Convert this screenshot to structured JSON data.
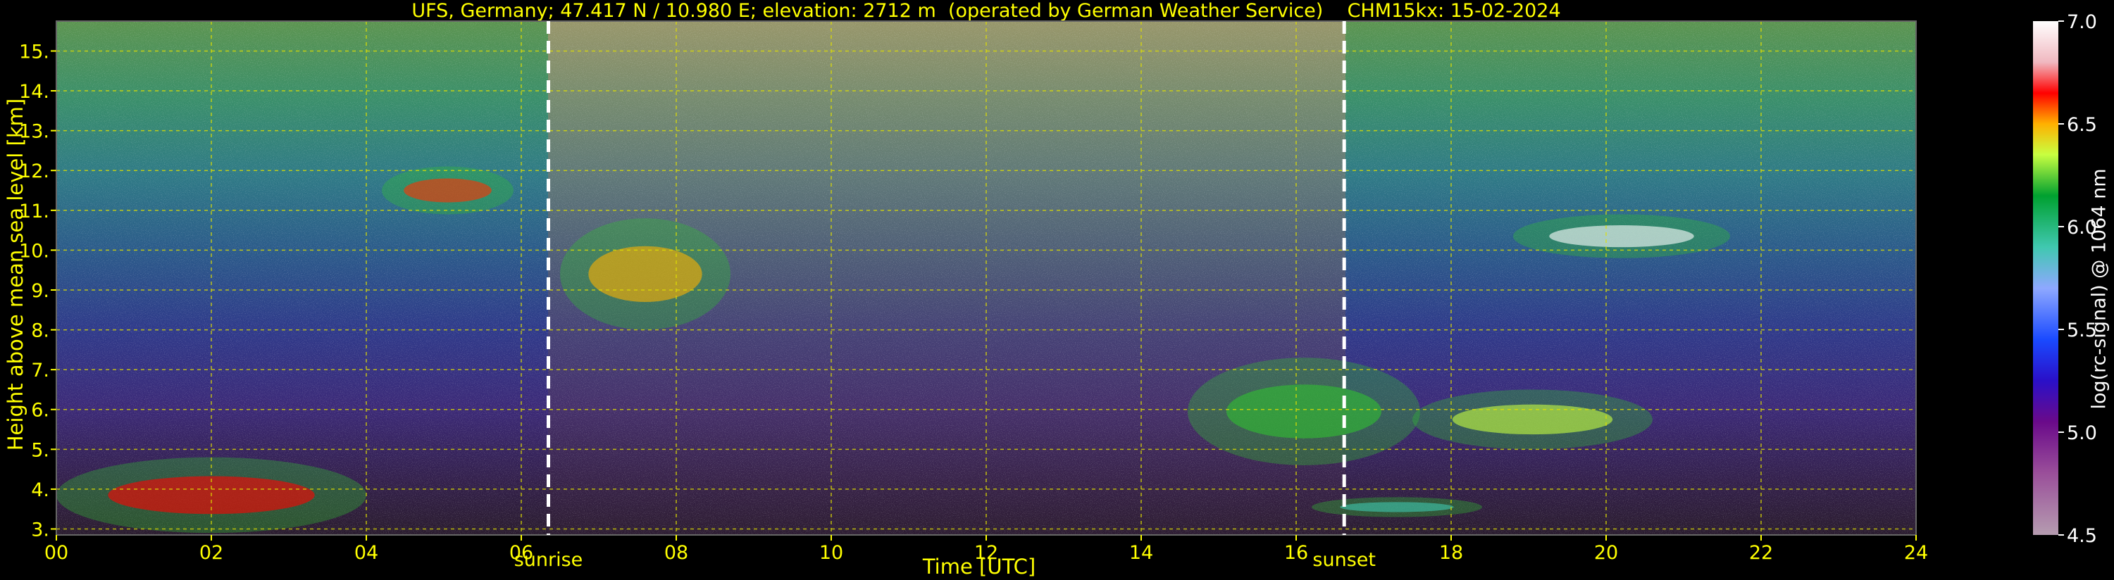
{
  "title": "UFS, Germany; 47.417 N / 10.980 E; elevation: 2712 m  (operated by German Weather Service)    CHM15kx: 15-02-2024",
  "chart_data": {
    "type": "heatmap",
    "title": "UFS, Germany; 47.417 N / 10.980 E; elevation: 2712 m  (operated by German Weather Service)    CHM15kx: 15-02-2024",
    "xlabel": "Time [UTC]",
    "ylabel": "Height above mean sea level [km]",
    "xlim": [
      0,
      24
    ],
    "ylim": [
      2.85,
      15.75
    ],
    "x_ticks": [
      "00",
      "02",
      "04",
      "06",
      "08",
      "10",
      "12",
      "14",
      "16",
      "18",
      "20",
      "22",
      "24"
    ],
    "y_ticks": [
      "3.",
      "4.",
      "5.",
      "6.",
      "7.",
      "8.",
      "9.",
      "10.",
      "11.",
      "12.",
      "13.",
      "14.",
      "15."
    ],
    "grid": true,
    "colorbar": {
      "label": "log(rc-signal) @ 1064 nm",
      "range": [
        4.5,
        7.0
      ],
      "ticks": [
        "4.5",
        "5.0",
        "5.5",
        "6.0",
        "6.5",
        "7.0"
      ]
    },
    "annotations": [
      {
        "label": "sunrise",
        "time": 6.35
      },
      {
        "label": "sunset",
        "time": 16.62
      }
    ],
    "features": [
      {
        "time_start": 4.2,
        "time_end": 5.9,
        "height_start": 10.9,
        "height_end": 12.1
      },
      {
        "time_start": 6.5,
        "time_end": 8.7,
        "height_start": 8.0,
        "height_end": 10.8
      },
      {
        "time_start": 14.6,
        "time_end": 17.6,
        "height_start": 4.6,
        "height_end": 7.3
      },
      {
        "time_start": 17.5,
        "time_end": 20.6,
        "height_start": 5.0,
        "height_end": 6.5
      },
      {
        "time_start": 18.8,
        "time_end": 21.6,
        "height_start": 9.8,
        "height_end": 10.9
      },
      {
        "time_start": 0.0,
        "time_end": 4.0,
        "height_start": 2.9,
        "height_end": 4.8
      },
      {
        "time_start": 16.2,
        "time_end": 18.4,
        "height_start": 3.3,
        "height_end": 3.8
      }
    ]
  }
}
